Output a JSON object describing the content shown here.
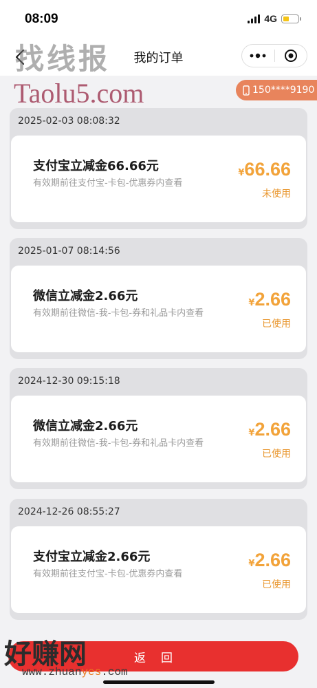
{
  "status_bar": {
    "time": "08:09",
    "network": "4G"
  },
  "nav": {
    "title": "我的订单"
  },
  "watermark": {
    "top_text": "找线报",
    "brand": "Taolu5.com",
    "bottom_text": "好赚网",
    "bottom_url_a": "www.zhuan",
    "bottom_url_b": "yes",
    "bottom_url_c": ".com"
  },
  "phone": {
    "masked": "150****9190"
  },
  "orders": [
    {
      "date": "2025-02-03 08:08:32",
      "title": "支付宝立减金66.66元",
      "desc": "有效期前往支付宝-卡包-优惠券内查看",
      "currency": "¥",
      "amount": "66.66",
      "status": "未使用"
    },
    {
      "date": "2025-01-07 08:14:56",
      "title": "微信立减金2.66元",
      "desc": "有效期前往微信-我-卡包-券和礼品卡内查看",
      "currency": "¥",
      "amount": "2.66",
      "status": "已使用"
    },
    {
      "date": "2024-12-30 09:15:18",
      "title": "微信立减金2.66元",
      "desc": "有效期前往微信-我-卡包-券和礼品卡内查看",
      "currency": "¥",
      "amount": "2.66",
      "status": "已使用"
    },
    {
      "date": "2024-12-26 08:55:27",
      "title": "支付宝立减金2.66元",
      "desc": "有效期前往支付宝-卡包-优惠券内查看",
      "currency": "¥",
      "amount": "2.66",
      "status": "已使用"
    }
  ],
  "footer": {
    "back_label": "返回"
  }
}
